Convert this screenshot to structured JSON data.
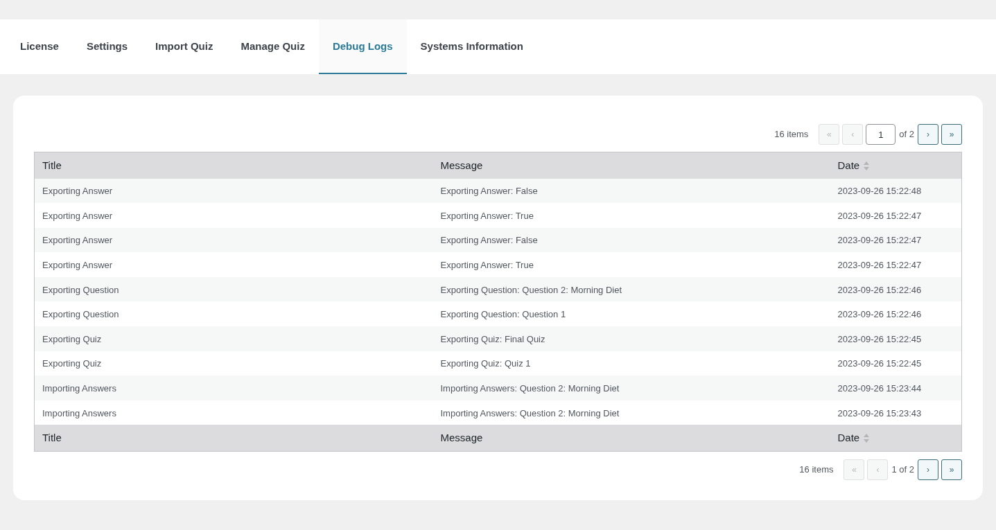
{
  "tabs": [
    {
      "label": "License",
      "selected": false
    },
    {
      "label": "Settings",
      "selected": false
    },
    {
      "label": "Import Quiz",
      "selected": false
    },
    {
      "label": "Manage Quiz",
      "selected": false
    },
    {
      "label": "Debug Logs",
      "selected": true
    },
    {
      "label": "Systems Information",
      "selected": false
    }
  ],
  "pagination_top": {
    "count": "16 items",
    "controls": [
      {
        "kind": "button",
        "symbol": "«",
        "disabled": true
      },
      {
        "kind": "button",
        "symbol": "‹",
        "disabled": true
      },
      {
        "kind": "page_input",
        "value": "1"
      },
      {
        "kind": "text",
        "text": "of 2"
      },
      {
        "kind": "button",
        "symbol": "›",
        "disabled": false
      },
      {
        "kind": "button",
        "symbol": "»",
        "disabled": false
      }
    ]
  },
  "table": {
    "columns": [
      {
        "label": "Title",
        "sortable": false
      },
      {
        "label": "Message",
        "sortable": false
      },
      {
        "label": "Date",
        "sortable": true
      }
    ],
    "rows": [
      {
        "title": "Exporting Answer",
        "message": "Exporting Answer: False",
        "date": "2023-09-26 15:22:48"
      },
      {
        "title": "Exporting Answer",
        "message": "Exporting Answer: True",
        "date": "2023-09-26 15:22:47"
      },
      {
        "title": "Exporting Answer",
        "message": "Exporting Answer: False",
        "date": "2023-09-26 15:22:47"
      },
      {
        "title": "Exporting Answer",
        "message": "Exporting Answer: True",
        "date": "2023-09-26 15:22:47"
      },
      {
        "title": "Exporting Question",
        "message": "Exporting Question: Question 2: Morning Diet",
        "date": "2023-09-26 15:22:46"
      },
      {
        "title": "Exporting Question",
        "message": "Exporting Question: Question 1",
        "date": "2023-09-26 15:22:46"
      },
      {
        "title": "Exporting Quiz",
        "message": "Exporting Quiz: Final Quiz",
        "date": "2023-09-26 15:22:45"
      },
      {
        "title": "Exporting Quiz",
        "message": "Exporting Quiz: Quiz 1",
        "date": "2023-09-26 15:22:45"
      },
      {
        "title": "Importing Answers",
        "message": "Importing Answers: Question 2: Morning Diet",
        "date": "2023-09-26 15:23:44"
      },
      {
        "title": "Importing Answers",
        "message": "Importing Answers: Question 2: Morning Diet",
        "date": "2023-09-26 15:23:43"
      }
    ],
    "footer_columns": [
      {
        "label": "Title",
        "sortable": false
      },
      {
        "label": "Message",
        "sortable": false
      },
      {
        "label": "Date",
        "sortable": true
      }
    ]
  },
  "pagination_bottom": {
    "count": "16 items",
    "controls": [
      {
        "kind": "button",
        "symbol": "«",
        "disabled": true
      },
      {
        "kind": "button",
        "symbol": "‹",
        "disabled": true
      },
      {
        "kind": "text",
        "text": "1 of 2"
      },
      {
        "kind": "button",
        "symbol": "›",
        "disabled": false
      },
      {
        "kind": "button",
        "symbol": "»",
        "disabled": false
      }
    ]
  }
}
